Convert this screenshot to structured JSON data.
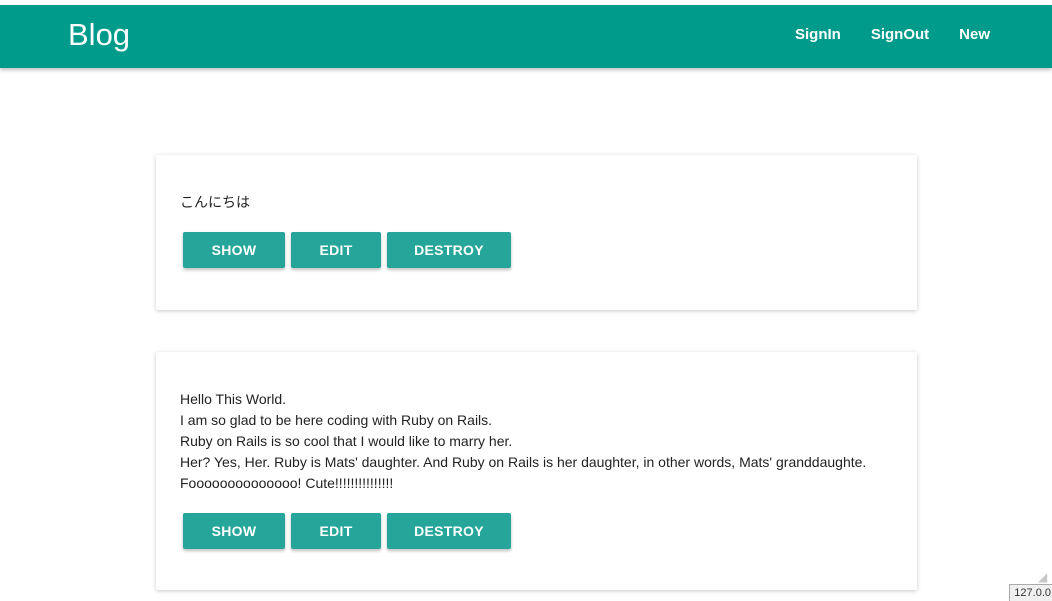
{
  "header": {
    "brand": "Blog",
    "nav": [
      "SignIn",
      "SignOut",
      "New"
    ]
  },
  "posts": [
    {
      "text": "こんにちは",
      "buttons": {
        "show": "SHOW",
        "edit": "EDIT",
        "destroy": "DESTROY"
      }
    },
    {
      "text": "Hello This World.\nI am so glad to be here coding with Ruby on Rails.\nRuby on Rails is so cool that I would like to marry her.\nHer? Yes, Her. Ruby is Mats' daughter. And Ruby on Rails is her daughter, in other words, Mats' granddaughte.\nFoooooooooooooo! Cute!!!!!!!!!!!!!!!",
      "buttons": {
        "show": "SHOW",
        "edit": "EDIT",
        "destroy": "DESTROY"
      }
    }
  ],
  "status_bar": {
    "url": "127.0.0"
  },
  "colors": {
    "primary": "#009b8b",
    "button": "#26a69a"
  }
}
